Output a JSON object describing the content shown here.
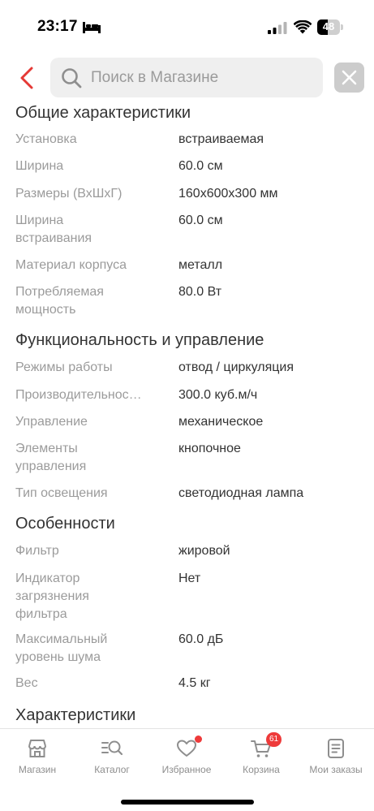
{
  "status_bar": {
    "time": "23:17",
    "battery_text": "48",
    "battery_level": 0.48
  },
  "search": {
    "placeholder": "Поиск в Магазине"
  },
  "sections": [
    {
      "title": "Общие характеристики",
      "rows": [
        {
          "label": "Установка",
          "value": "встраиваемая"
        },
        {
          "label": "Ширина",
          "value": "60.0 см"
        },
        {
          "label": "Размеры (ВхШхГ)",
          "value": "160x600x300 мм"
        },
        {
          "label": "Ширина встраивания",
          "value": "60.0 см"
        },
        {
          "label": "Материал корпуса",
          "value": "металл"
        },
        {
          "label": "Потребляемая мощность",
          "value": "80.0 Вт"
        }
      ]
    },
    {
      "title": "Функциональность и управление",
      "rows": [
        {
          "label": "Режимы работы",
          "value": "отвод / циркуляция"
        },
        {
          "label": "Производительнос…",
          "value": "300.0 куб.м/ч"
        },
        {
          "label": "Управление",
          "value": "механическое"
        },
        {
          "label": "Элементы управления",
          "value": "кнопочное"
        },
        {
          "label": "Тип освещения",
          "value": "светодиодная лампа"
        }
      ]
    },
    {
      "title": "Особенности",
      "rows": [
        {
          "label": "Фильтр",
          "value": "жировой"
        },
        {
          "label": "Индикатор загрязнения фильтра",
          "value": "Нет"
        },
        {
          "label": "Максимальный уровень шума",
          "value": "60.0 дБ"
        },
        {
          "label": "Вес",
          "value": "4.5 кг"
        }
      ]
    },
    {
      "title": "Характеристики",
      "rows": []
    }
  ],
  "tabbar": {
    "items": [
      {
        "label": "Магазин",
        "icon": "store-icon"
      },
      {
        "label": "Каталог",
        "icon": "catalog-search-icon"
      },
      {
        "label": "Избранное",
        "icon": "heart-icon"
      },
      {
        "label": "Корзина",
        "icon": "cart-icon",
        "badge": "61"
      },
      {
        "label": "Мои заказы",
        "icon": "orders-icon"
      }
    ]
  },
  "colors": {
    "accent": "#ee3a3a",
    "label_gray": "#9b9b9b",
    "text": "#333333"
  }
}
